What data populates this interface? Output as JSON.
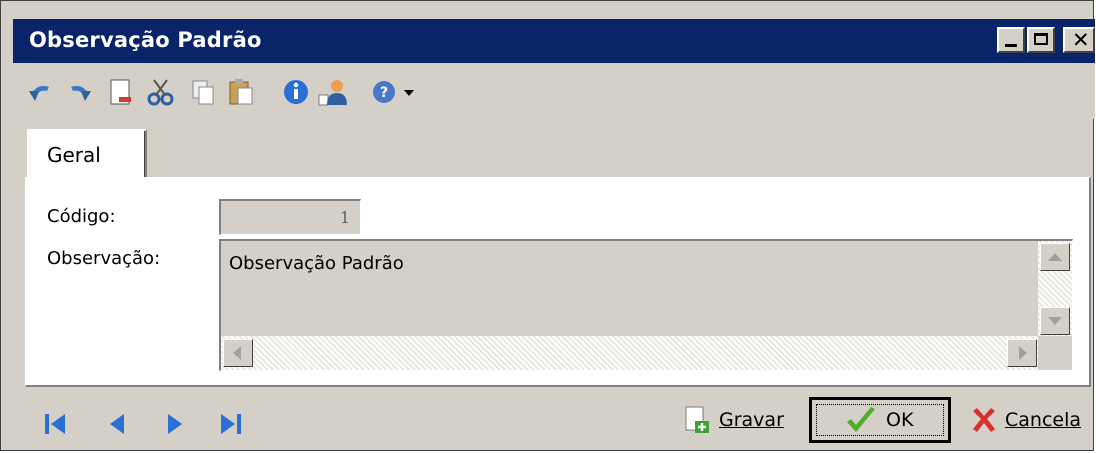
{
  "window": {
    "title": "Observação Padrão"
  },
  "tabs": [
    {
      "label": "Geral"
    }
  ],
  "form": {
    "codigo_label": "Código:",
    "codigo_value": "1",
    "observacao_label": "Observação:",
    "observacao_value": "Observação Padrão"
  },
  "buttons": {
    "gravar": "Gravar",
    "ok": "OK",
    "cancela": "Cancela"
  },
  "toolbar_icons": [
    "undo-icon",
    "redo-icon",
    "new-doc-icon",
    "cut-icon",
    "copy-icon",
    "paste-icon",
    "info-icon",
    "user-icon",
    "help-icon",
    "dropdown-arrow-icon"
  ],
  "nav_icons": [
    "first-record-icon",
    "previous-record-icon",
    "next-record-icon",
    "last-record-icon"
  ],
  "colors": {
    "titlebar": "#0a246a",
    "face": "#d4d0c8",
    "ok_check": "#4caf2a",
    "cancel_x": "#d9312b"
  }
}
